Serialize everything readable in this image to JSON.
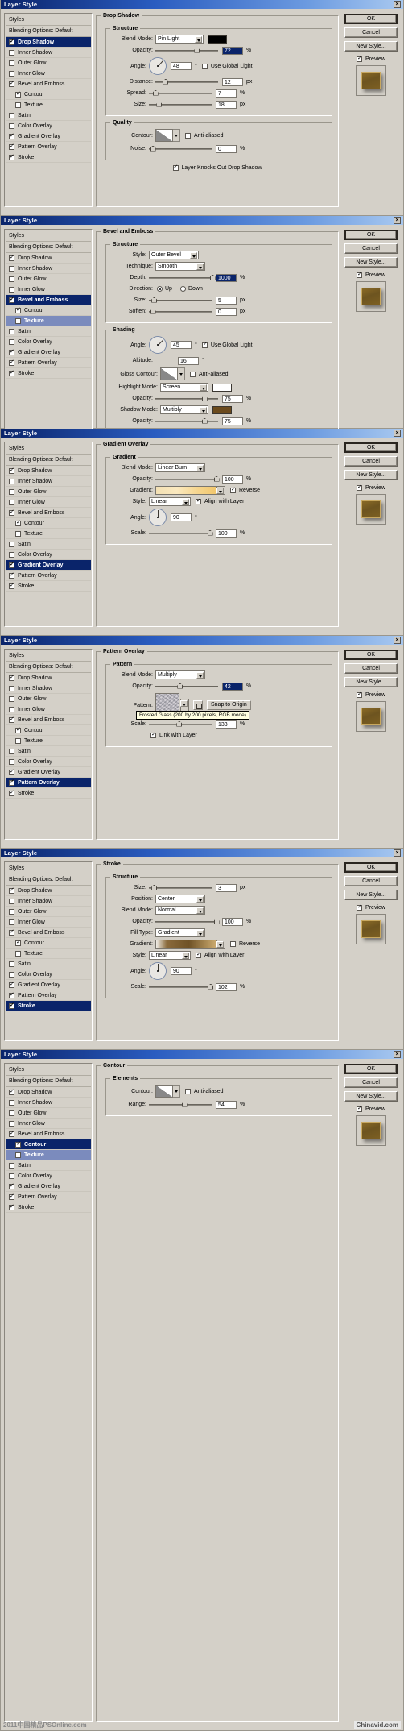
{
  "window": {
    "title": "Layer Style",
    "close_label": "×"
  },
  "buttons": {
    "ok": "OK",
    "cancel": "Cancel",
    "new_style": "New Style...",
    "preview": "Preview"
  },
  "styles_list": {
    "header": "Styles",
    "blending_options": "Blending Options: Default",
    "items": [
      {
        "label": "Drop Shadow",
        "checked": true,
        "indent": false
      },
      {
        "label": "Inner Shadow",
        "checked": false,
        "indent": false
      },
      {
        "label": "Outer Glow",
        "checked": false,
        "indent": false
      },
      {
        "label": "Inner Glow",
        "checked": false,
        "indent": false
      },
      {
        "label": "Bevel and Emboss",
        "checked": true,
        "indent": false
      },
      {
        "label": "Contour",
        "checked": true,
        "indent": true
      },
      {
        "label": "Texture",
        "checked": false,
        "indent": true
      },
      {
        "label": "Satin",
        "checked": false,
        "indent": false
      },
      {
        "label": "Color Overlay",
        "checked": false,
        "indent": false
      },
      {
        "label": "Gradient Overlay",
        "checked": true,
        "indent": false
      },
      {
        "label": "Pattern Overlay",
        "checked": true,
        "indent": false
      },
      {
        "label": "Stroke",
        "checked": true,
        "indent": false
      }
    ]
  },
  "panels": [
    {
      "id": "drop-shadow",
      "selected": "Drop Shadow",
      "title": "Drop Shadow",
      "sections": [
        {
          "legend": "Structure",
          "fields": [
            {
              "label": "Blend Mode:",
              "type": "select-swatch",
              "value": "Pin Light",
              "color": "#000000"
            },
            {
              "label": "Opacity:",
              "type": "slider-num",
              "value": "72",
              "unit": "%",
              "pct": 62,
              "highlight": true
            },
            {
              "label": "Angle:",
              "type": "dial",
              "value": "48",
              "unit": "°",
              "check_label": "Use Global Light",
              "checked": false,
              "deg": 48
            },
            {
              "label": "Distance:",
              "type": "slider-num",
              "value": "12",
              "unit": "px",
              "pct": 12
            },
            {
              "label": "Spread:",
              "type": "slider-num",
              "value": "7",
              "unit": "%",
              "pct": 6
            },
            {
              "label": "Size:",
              "type": "slider-num",
              "value": "18",
              "unit": "px",
              "pct": 12
            }
          ]
        },
        {
          "legend": "Quality",
          "fields": [
            {
              "label": "Contour:",
              "type": "contour",
              "check_label": "Anti-aliased",
              "checked": false
            },
            {
              "label": "Noise:",
              "type": "slider-num",
              "value": "0",
              "unit": "%",
              "pct": 2
            }
          ]
        }
      ],
      "footer_check": {
        "label": "Layer Knocks Out Drop Shadow",
        "checked": true
      }
    },
    {
      "id": "bevel-and-emboss",
      "selected": "Bevel and Emboss",
      "title": "Bevel and Emboss",
      "sections": [
        {
          "legend": "Structure",
          "fields": [
            {
              "label": "Style:",
              "type": "select",
              "value": "Outer Bevel"
            },
            {
              "label": "Technique:",
              "type": "select",
              "value": "Smooth"
            },
            {
              "label": "Depth:",
              "type": "slider-num",
              "value": "1000",
              "unit": "%",
              "pct": 97,
              "highlight": true
            },
            {
              "label": "Direction:",
              "type": "radios",
              "options": [
                "Up",
                "Down"
              ],
              "selected": "Up"
            },
            {
              "label": "Size:",
              "type": "slider-num",
              "value": "5",
              "unit": "px",
              "pct": 4
            },
            {
              "label": "Soften:",
              "type": "slider-num",
              "value": "0",
              "unit": "px",
              "pct": 2
            }
          ]
        },
        {
          "legend": "Shading",
          "fields": [
            {
              "label": "Angle:",
              "type": "dial",
              "value": "45",
              "unit": "°",
              "check_label": "Use Global Light",
              "checked": true,
              "deg": 45
            },
            {
              "label": "Altitude:",
              "type": "num-only",
              "value": "16",
              "unit": "°"
            },
            {
              "label": "Gloss Contour:",
              "type": "contour",
              "check_label": "Anti-aliased",
              "checked": false
            },
            {
              "label": "Highlight Mode:",
              "type": "select-swatch",
              "value": "Screen",
              "color": "#ffffff"
            },
            {
              "label": "Opacity:",
              "type": "slider-num",
              "value": "75",
              "unit": "%",
              "pct": 74
            },
            {
              "label": "Shadow Mode:",
              "type": "select-swatch",
              "value": "Multiply",
              "color": "#6b4a1c"
            },
            {
              "label": "Opacity:",
              "type": "slider-num",
              "value": "75",
              "unit": "%",
              "pct": 74
            }
          ]
        }
      ]
    },
    {
      "id": "gradient-overlay",
      "selected": "Gradient Overlay",
      "title": "Gradient Overlay",
      "sections": [
        {
          "legend": "Gradient",
          "fields": [
            {
              "label": "Blend Mode:",
              "type": "select",
              "value": "Linear Burn"
            },
            {
              "label": "Opacity:",
              "type": "slider-num",
              "value": "100",
              "unit": "%",
              "pct": 93
            },
            {
              "label": "Gradient:",
              "type": "gradient",
              "check_label": "Reverse",
              "checked": true,
              "gradient": "linear-gradient(to right,#f3e0b4 0%,#fbe9bf 35%,#f6d58d 70%,#f2c76d 100%)"
            },
            {
              "label": "Style:",
              "type": "select-chk",
              "value": "Linear",
              "check_label": "Align with Layer",
              "checked": true
            },
            {
              "label": "Angle:",
              "type": "dial",
              "value": "90",
              "unit": "°",
              "deg": 90
            },
            {
              "label": "Scale:",
              "type": "slider-num",
              "value": "100",
              "unit": "%",
              "pct": 93
            }
          ]
        }
      ]
    },
    {
      "id": "pattern-overlay",
      "selected": "Pattern Overlay",
      "title": "Pattern Overlay",
      "sections": [
        {
          "legend": "Pattern",
          "fields": [
            {
              "label": "Blend Mode:",
              "type": "select",
              "value": "Multiply"
            },
            {
              "label": "Opacity:",
              "type": "slider-num",
              "value": "42",
              "unit": "%",
              "pct": 35,
              "highlight": true
            },
            {
              "label": "Pattern:",
              "type": "pattern",
              "button_label": "Snap to Origin",
              "tooltip": "Frosted Glass (200 by 200 pixels, RGB mode)"
            },
            {
              "label": "Scale:",
              "type": "slider-num",
              "value": "133",
              "unit": "%",
              "pct": 44
            },
            {
              "label": "",
              "type": "checkbox",
              "check_label": "Link with Layer",
              "checked": true
            }
          ]
        }
      ]
    },
    {
      "id": "stroke",
      "selected": "Stroke",
      "title": "Stroke",
      "sections": [
        {
          "legend": "Structure",
          "fields": [
            {
              "label": "Size:",
              "type": "slider-num",
              "value": "3",
              "unit": "px",
              "pct": 4
            },
            {
              "label": "Position:",
              "type": "select",
              "value": "Center"
            },
            {
              "label": "Blend Mode:",
              "type": "select",
              "value": "Normal"
            },
            {
              "label": "Opacity:",
              "type": "slider-num",
              "value": "100",
              "unit": "%",
              "pct": 93
            },
            {
              "label": "Fill Type:",
              "type": "select",
              "value": "Gradient"
            },
            {
              "label": "Gradient:",
              "type": "gradient",
              "check_label": "Reverse",
              "checked": false,
              "gradient": "linear-gradient(to right,#f0ede6 0%,#8a6a3c 18%,#6f5226 55%,#caa96e 100%)"
            },
            {
              "label": "Style:",
              "type": "select-chk",
              "value": "Linear",
              "check_label": "Align with Layer",
              "checked": true
            },
            {
              "label": "Angle:",
              "type": "dial",
              "value": "90",
              "unit": "°",
              "deg": 90
            },
            {
              "label": "Scale:",
              "type": "slider-num",
              "value": "102",
              "unit": "%",
              "pct": 94
            }
          ]
        }
      ]
    },
    {
      "id": "contour",
      "selected": "Contour",
      "title": "Contour",
      "sections": [
        {
          "legend": "Elements",
          "fields": [
            {
              "label": "Contour:",
              "type": "contour",
              "check_label": "Anti-aliased",
              "checked": false
            },
            {
              "label": "Range:",
              "type": "slider-num",
              "value": "54",
              "unit": "%",
              "pct": 52
            }
          ]
        }
      ]
    }
  ],
  "watermarks": {
    "left": "2011中国精品PSOnline.com",
    "right": "Chinavid.com"
  }
}
